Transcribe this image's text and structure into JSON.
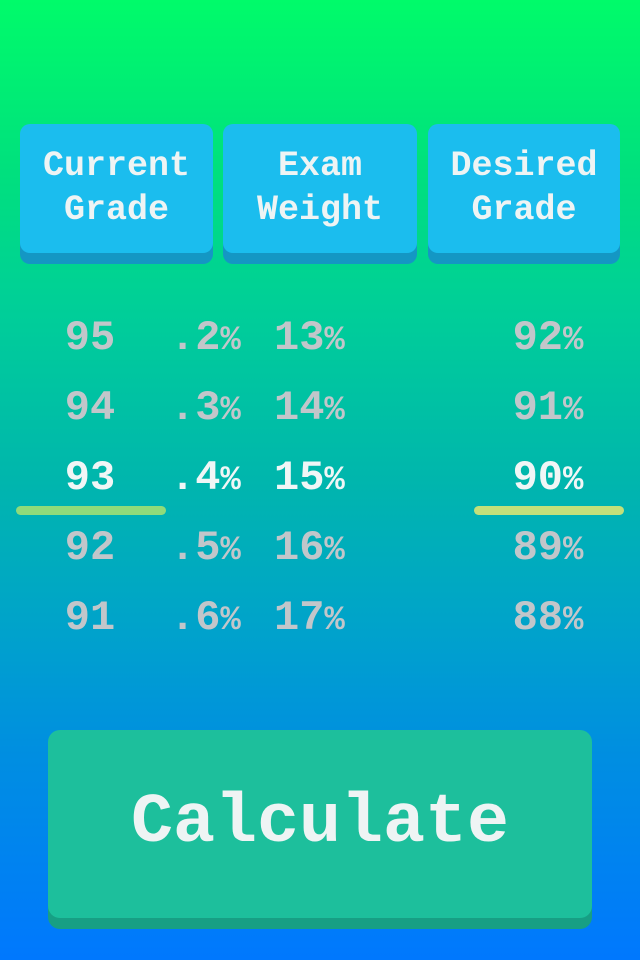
{
  "headers": {
    "current_grade": [
      "Current",
      "Grade"
    ],
    "exam_weight": [
      "Exam",
      "Weight"
    ],
    "desired_grade": [
      "Desired",
      "Grade"
    ]
  },
  "pickers": {
    "current_grade": {
      "items": [
        "95",
        "94",
        "93",
        "92",
        "91"
      ],
      "selected_index": 2,
      "selected_value": "93"
    },
    "exam_weight_decimal": {
      "items": [
        ".2",
        ".3",
        ".4",
        ".5",
        ".6"
      ],
      "suffix": "%",
      "selected_index": 2,
      "selected_value": ".4%"
    },
    "exam_weight_integer": {
      "items": [
        "13",
        "14",
        "15",
        "16",
        "17"
      ],
      "suffix": "%",
      "selected_index": 2,
      "selected_value": "15%"
    },
    "desired_grade": {
      "items": [
        "92",
        "91",
        "90",
        "89",
        "88"
      ],
      "suffix": "%",
      "selected_index": 2,
      "selected_value": "90%"
    }
  },
  "calculate_button": {
    "label": "Calculate"
  },
  "colors": {
    "background_top": "#00fb6a",
    "background_bottom": "#0078fe",
    "header_button": "#1bbdee",
    "calculate_button": "#1dbf9c",
    "selection_line": "#8fdb7a",
    "selected_text": "#f0f6f6",
    "unselected_text": "#c2c6ca"
  }
}
